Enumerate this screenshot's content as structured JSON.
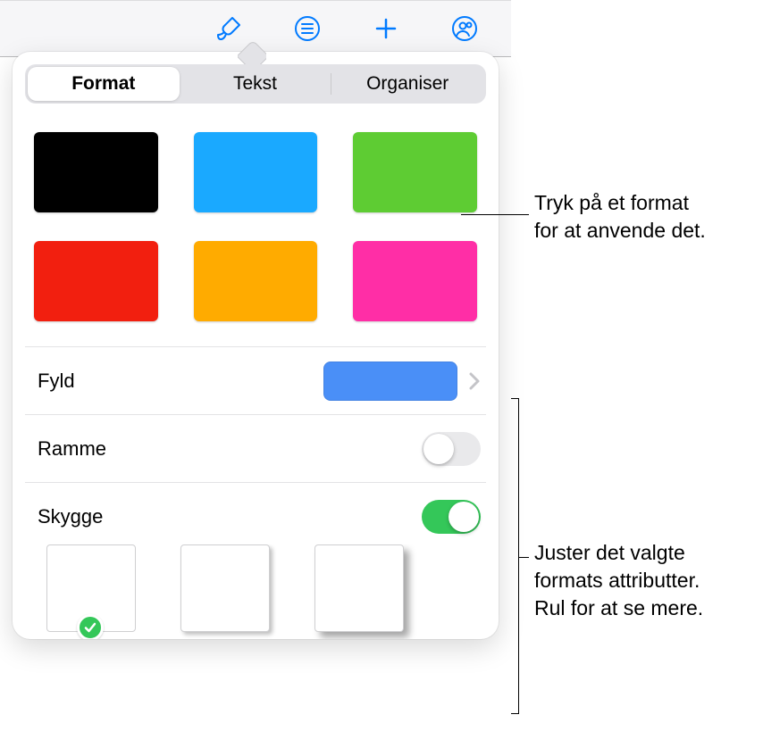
{
  "toolbar": {
    "icons": [
      "format-brush-icon",
      "list-icon",
      "add-icon",
      "collaborate-icon"
    ]
  },
  "tabs": {
    "format": "Format",
    "text": "Tekst",
    "organize": "Organiser",
    "active": "format"
  },
  "style_swatches": [
    {
      "name": "style-black",
      "color": "#000000"
    },
    {
      "name": "style-blue",
      "color": "#1aa9ff"
    },
    {
      "name": "style-green",
      "color": "#5ecc33"
    },
    {
      "name": "style-red",
      "color": "#f21f0f"
    },
    {
      "name": "style-orange",
      "color": "#ffab00"
    },
    {
      "name": "style-magenta",
      "color": "#ff2ea6"
    }
  ],
  "fill": {
    "label": "Fyld",
    "color": "#4a8ff7"
  },
  "border": {
    "label": "Ramme",
    "enabled": false
  },
  "shadow": {
    "label": "Skygge",
    "enabled": true,
    "selected_preset": 0,
    "presets": [
      "none",
      "soft",
      "strong"
    ]
  },
  "callouts": {
    "style_hint": "Tryk på et format\nfor at anvende det.",
    "attributes_hint": "Juster det valgte\nformats attributter.\nRul for at se mere."
  }
}
